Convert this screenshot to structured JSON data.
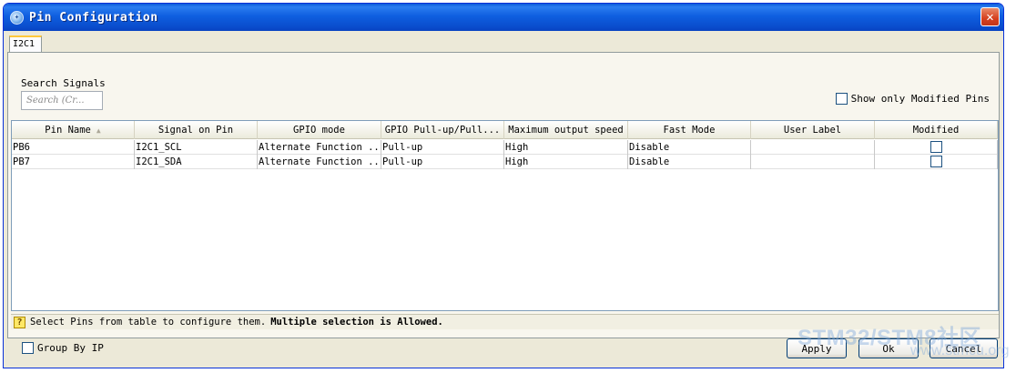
{
  "window": {
    "title": "Pin Configuration",
    "close_symbol": "✕",
    "app_icon": "shield-icon"
  },
  "tabs": [
    {
      "label": "I2C1",
      "selected": true
    }
  ],
  "search": {
    "label": "Search Signals",
    "placeholder": "Search (Cr..."
  },
  "show_modified": {
    "label": "Show only Modified Pins",
    "checked": false
  },
  "table": {
    "columns": [
      "Pin Name",
      "Signal on Pin",
      "GPIO mode",
      "GPIO Pull-up/Pull...",
      "Maximum output speed",
      "Fast Mode",
      "User Label",
      "Modified"
    ],
    "sort_indicator": "▲",
    "rows": [
      {
        "pin": "PB6",
        "signal": "I2C1_SCL",
        "mode": "Alternate Function ...",
        "pull": "Pull-up",
        "speed": "High",
        "fast": "Disable",
        "label": "",
        "modified": false
      },
      {
        "pin": "PB7",
        "signal": "I2C1_SDA",
        "mode": "Alternate Function ...",
        "pull": "Pull-up",
        "speed": "High",
        "fast": "Disable",
        "label": "",
        "modified": false
      }
    ]
  },
  "status": {
    "icon": "help-icon",
    "icon_glyph": "?",
    "text": "Select Pins from table to configure them.",
    "bold_text": "Multiple selection is Allowed."
  },
  "group_by": {
    "label": "Group By IP",
    "checked": false
  },
  "buttons": {
    "apply": "Apply",
    "ok": "Ok",
    "cancel": "Cancel"
  },
  "watermark": {
    "text": "STM32/STM8社区",
    "sub": "www.stmcu.org"
  },
  "colors": {
    "title_bar": "#0a4fcf",
    "close_button": "#d6401e",
    "dialog_bg": "#ece9d8",
    "tab_highlight": "#ffc83c"
  }
}
